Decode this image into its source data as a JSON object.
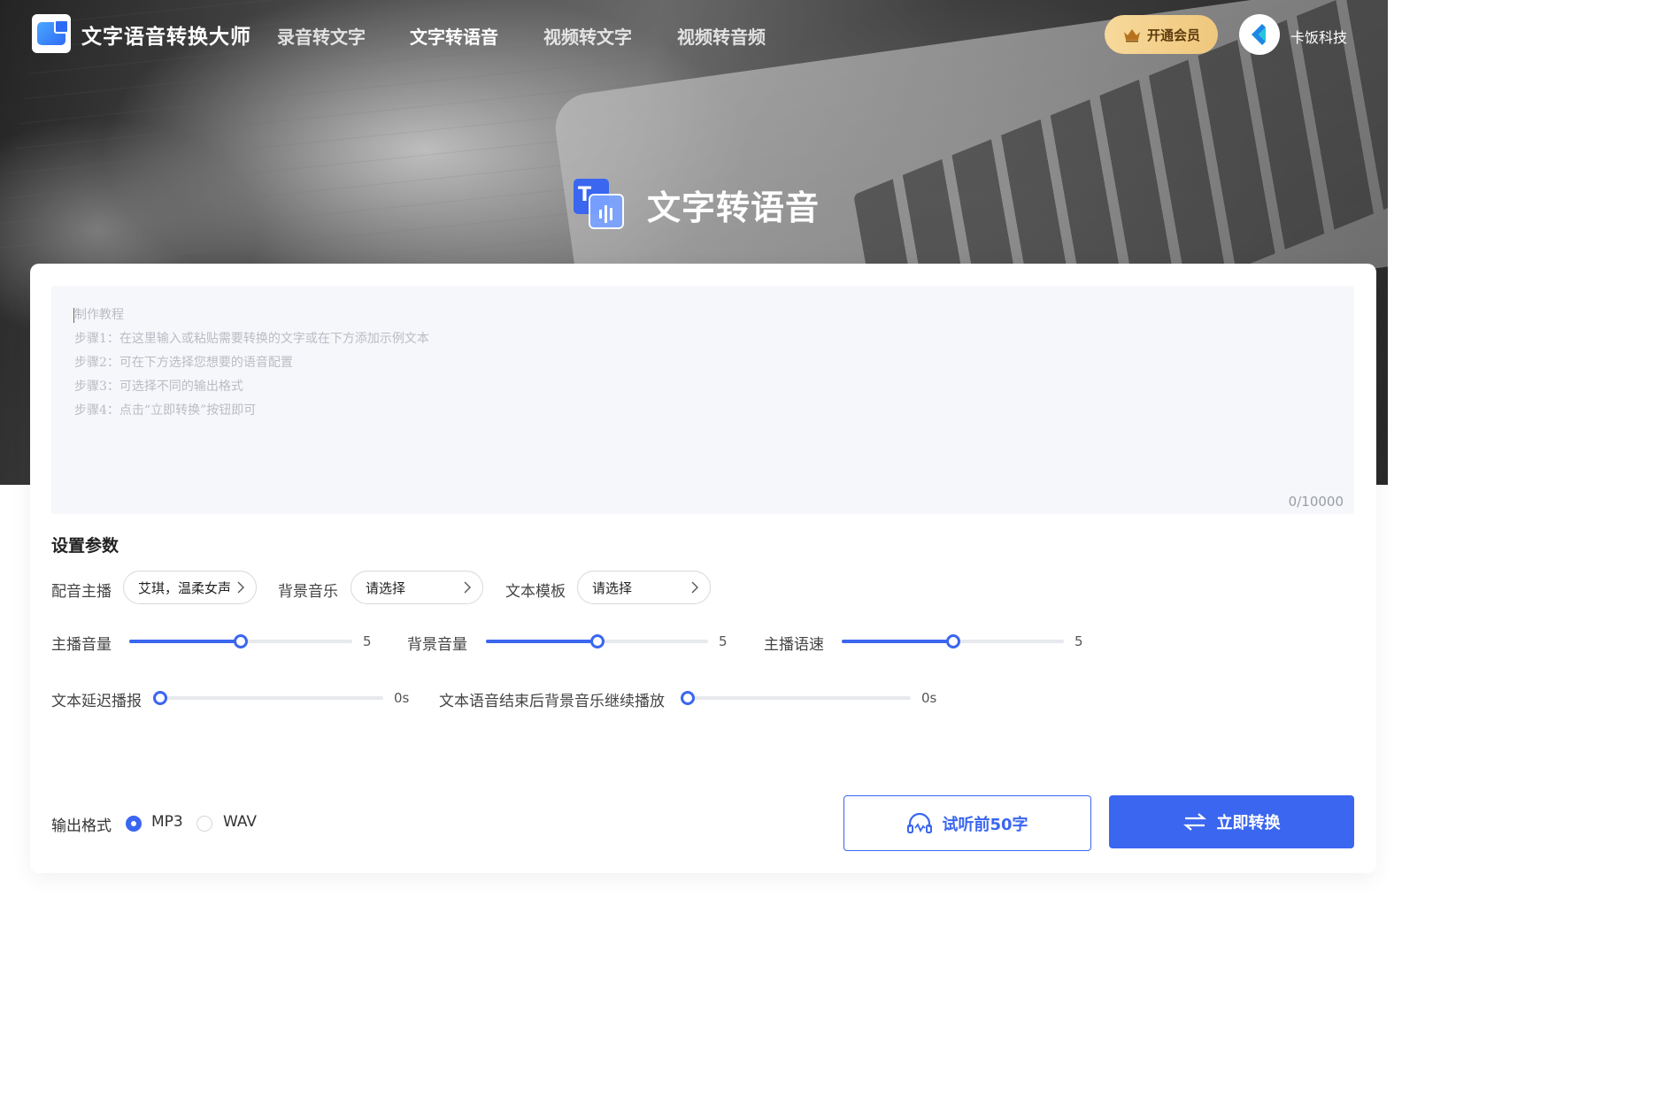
{
  "app": {
    "title": "文字语音转换大师"
  },
  "nav": {
    "items": [
      {
        "label": "录音转文字",
        "active": false
      },
      {
        "label": "文字转语音",
        "active": true
      },
      {
        "label": "视频转文字",
        "active": false
      },
      {
        "label": "视频转音频",
        "active": false
      }
    ],
    "vip_label": "开通会员",
    "vip_icon": "crown-icon",
    "user_name": "卡饭科技"
  },
  "hero": {
    "title": "文字转语音",
    "icon": "text-to-speech-icon"
  },
  "editor": {
    "placeholder_lines": [
      "制作教程",
      "步骤1：在这里输入或粘贴需要转换的文字或在下方添加示例文本",
      "步骤2：可在下方选择您想要的语音配置",
      "步骤3：可选择不同的输出格式",
      "步骤4：点击“立即转换”按钮即可"
    ],
    "counter": "0/10000"
  },
  "settings": {
    "title": "设置参数",
    "voice": {
      "label": "配音主播",
      "value": "艾琪，温柔女声"
    },
    "bgm": {
      "label": "背景音乐",
      "value": "请选择"
    },
    "template": {
      "label": "文本模板",
      "value": "请选择"
    },
    "anchor_volume": {
      "label": "主播音量",
      "value": "5",
      "level": 0.5
    },
    "bgm_volume": {
      "label": "背景音量",
      "value": "5",
      "level": 0.5
    },
    "speed": {
      "label": "主播语速",
      "value": "5",
      "level": 0.5
    },
    "delay": {
      "label": "文本延迟播报",
      "value": "0s",
      "level": 0
    },
    "bgm_after": {
      "label": "文本语音结束后背景音乐继续播放",
      "value": "0s",
      "level": 0
    }
  },
  "output": {
    "label": "输出格式",
    "options": [
      {
        "label": "MP3",
        "selected": true
      },
      {
        "label": "WAV",
        "selected": false
      }
    ]
  },
  "actions": {
    "preview_label": "试听前50字",
    "preview_icon": "headphones-icon",
    "convert_label": "立即转换",
    "convert_icon": "swap-arrows-icon"
  },
  "colors": {
    "accent": "#3a66f0",
    "vip": "#f2cf8a"
  }
}
